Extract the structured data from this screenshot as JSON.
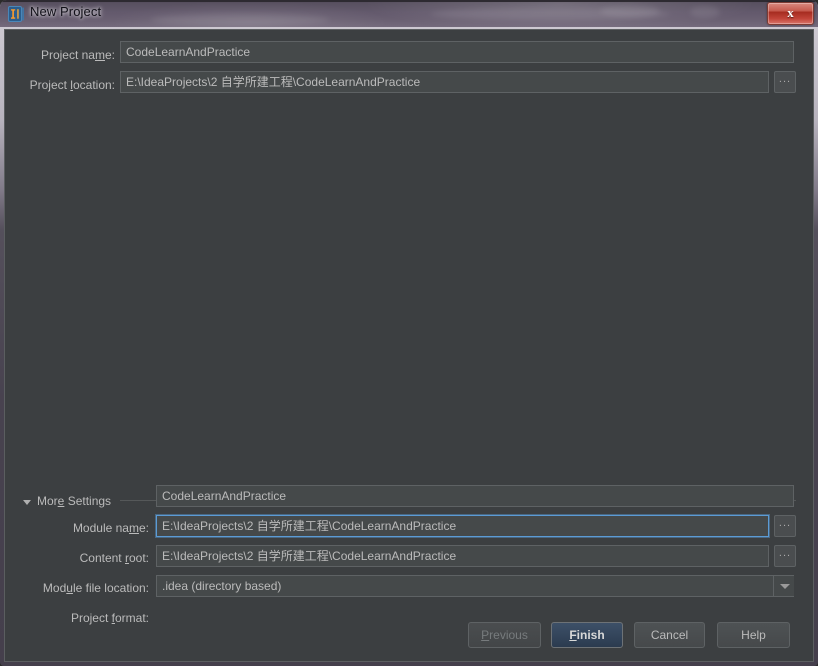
{
  "window": {
    "title": "New Project",
    "app_icon": "intellij-idea-icon",
    "close_label": "x",
    "close_icon": "close-icon"
  },
  "top_form": {
    "project_name": {
      "label_before": "Project na",
      "label_mnemonic": "m",
      "label_after": "e:",
      "value": "CodeLearnAndPractice"
    },
    "project_location": {
      "label_before": "Project ",
      "label_mnemonic": "l",
      "label_after": "ocation:",
      "value": "E:\\IdeaProjects\\2 自学所建工程\\CodeLearnAndPractice",
      "browse_label": "..."
    }
  },
  "more_settings": {
    "label_before": "Mor",
    "label_mnemonic": "e",
    "label_after": " Settings",
    "expanded": true,
    "collapse_icon": "triangle-down-icon",
    "module_name": {
      "label_before": "Module na",
      "label_mnemonic": "m",
      "label_after": "e:",
      "value": "CodeLearnAndPractice"
    },
    "content_root": {
      "label_before": "Content ",
      "label_mnemonic": "r",
      "label_after": "oot:",
      "value": "E:\\IdeaProjects\\2 自学所建工程\\CodeLearnAndPractice",
      "browse_label": "...",
      "focused": true
    },
    "module_file_location": {
      "label_before": "Mod",
      "label_mnemonic": "u",
      "label_after": "le file location:",
      "value": "E:\\IdeaProjects\\2 自学所建工程\\CodeLearnAndPractice",
      "browse_label": "..."
    },
    "project_format": {
      "label_before": "Project ",
      "label_mnemonic": "f",
      "label_after": "ormat:",
      "value": ".idea (directory based)",
      "dropdown_icon": "chevron-down-icon",
      "options": [
        ".idea (directory based)"
      ]
    }
  },
  "footer": {
    "previous": {
      "before": "",
      "mnemonic": "P",
      "after": "revious",
      "enabled": false
    },
    "finish": {
      "before": "",
      "mnemonic": "F",
      "after": "inish",
      "is_default": true
    },
    "cancel": {
      "before": "Cancel",
      "mnemonic": "",
      "after": ""
    },
    "help": {
      "before": "Help",
      "mnemonic": "",
      "after": ""
    }
  },
  "colors": {
    "dialog_background": "#3c3f41",
    "field_background": "#45494a",
    "text": "#bbbbbb",
    "focus_border": "#5b9bd5",
    "default_button": "#2b3b4f",
    "close_button": "#c4564a"
  }
}
